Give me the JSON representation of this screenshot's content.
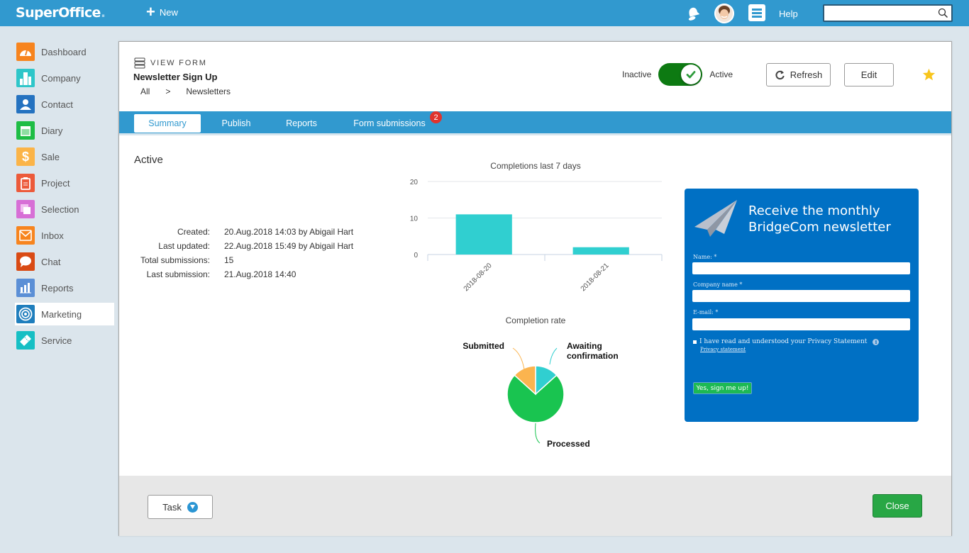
{
  "topbar": {
    "logo": "SuperOffice",
    "logo_dot": ".",
    "new_label": "New",
    "help_label": "Help",
    "search_value": "",
    "search_placeholder": ""
  },
  "sidebar": {
    "items": [
      {
        "label": "Dashboard",
        "icon": "dashboard-icon",
        "color": "#f7841e"
      },
      {
        "label": "Company",
        "icon": "company-icon",
        "color": "#2ec6c9"
      },
      {
        "label": "Contact",
        "icon": "contact-icon",
        "color": "#2472c0"
      },
      {
        "label": "Diary",
        "icon": "diary-icon",
        "color": "#1ebd45"
      },
      {
        "label": "Sale",
        "icon": "sale-icon",
        "color": "#fbb448"
      },
      {
        "label": "Project",
        "icon": "project-icon",
        "color": "#ec5a3a"
      },
      {
        "label": "Selection",
        "icon": "selection-icon",
        "color": "#d76fd6"
      },
      {
        "label": "Inbox",
        "icon": "inbox-icon",
        "color": "#f7841e"
      },
      {
        "label": "Chat",
        "icon": "chat-icon",
        "color": "#d94a14"
      },
      {
        "label": "Reports",
        "icon": "reports-icon",
        "color": "#5b8fd6"
      },
      {
        "label": "Marketing",
        "icon": "marketing-icon",
        "color": "#1f7ebd",
        "active": true
      },
      {
        "label": "Service",
        "icon": "service-icon",
        "color": "#16bfc4"
      }
    ]
  },
  "header": {
    "view_label": "VIEW FORM",
    "title": "Newsletter Sign Up",
    "breadcrumb": [
      "All",
      ">",
      "Newsletters"
    ],
    "toggle": {
      "off_label": "Inactive",
      "on_label": "Active",
      "state": "on"
    },
    "refresh_label": "Refresh",
    "edit_label": "Edit",
    "favorite": true
  },
  "tabs": [
    {
      "label": "Summary",
      "active": true
    },
    {
      "label": "Publish"
    },
    {
      "label": "Reports"
    },
    {
      "label": "Form submissions",
      "badge": "2"
    }
  ],
  "summary": {
    "status": "Active",
    "details": [
      {
        "label": "Created:",
        "value": "20.Aug.2018 14:03 by Abigail Hart"
      },
      {
        "label": "Last updated:",
        "value": "22.Aug.2018 15:49 by Abigail Hart"
      },
      {
        "label": "Total submissions:",
        "value": "15"
      },
      {
        "label": "Last submission:",
        "value": "21.Aug.2018 14:40"
      }
    ]
  },
  "chart_data": [
    {
      "type": "bar",
      "title": "Completions last 7 days",
      "categories": [
        "2018-08-20",
        "2018-08-21"
      ],
      "values": [
        11,
        2
      ],
      "yticks": [
        0,
        10,
        20
      ],
      "ylim": [
        0,
        20
      ],
      "xlabel": "",
      "ylabel": "",
      "grid": true,
      "color": "#30cfd0"
    },
    {
      "type": "pie",
      "title": "Completion rate",
      "slices": [
        {
          "label": "Awaiting confirmation",
          "value": 2,
          "color": "#30cfd0"
        },
        {
          "label": "Processed",
          "value": 11,
          "color": "#19c450"
        },
        {
          "label": "Submitted",
          "value": 2,
          "color": "#fbb44f"
        }
      ]
    }
  ],
  "preview": {
    "heading_line1": "Receive the monthly",
    "heading_line2": "BridgeCom newsletter",
    "name_label": "Name: *",
    "company_label": "Company name *",
    "email_label": "E-mail: *",
    "consent_label": "I have read and understood your Privacy Statement",
    "privacy_link": "Privacy statement",
    "submit_label": "Yes, sign me up!",
    "bg_color": "#0070c4"
  },
  "footer": {
    "task_label": "Task",
    "close_label": "Close"
  }
}
